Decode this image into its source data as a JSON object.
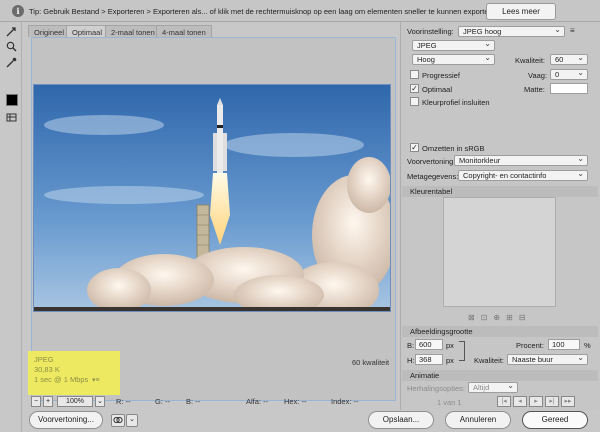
{
  "tipbar": {
    "tip": "Tip: Gebruik Bestand > Exporteren > Exporteren als... of klik met de rechtermuisknop op een laag om elementen sneller te kunnen exporteren",
    "button": "Lees meer"
  },
  "tabs": [
    "Origineel",
    "Optimaal",
    "2-maal tonen",
    "4-maal tonen"
  ],
  "preview": {
    "info": [
      "JPEG",
      "30,83 K",
      "1 sec @ 1 Mbps"
    ],
    "quality": "60 kwaliteit"
  },
  "status": {
    "zoom": "100%",
    "r": "R: --",
    "g": "G: --",
    "b": "B: --",
    "alfa": "Alfa: --",
    "hex": "Hex: --",
    "index": "Index: --"
  },
  "buttons": {
    "preview": "Voorvertoning...",
    "save": "Opslaan...",
    "cancel": "Annuleren",
    "done": "Gereed"
  },
  "settings": {
    "preset_label": "Voorinstelling:",
    "preset": "JPEG hoog",
    "format": "JPEG",
    "quality_level": "Hoog",
    "quality_label": "Kwaliteit:",
    "quality_value": "60",
    "progressive": "Progressief",
    "blur_label": "Vaag:",
    "blur_value": "0",
    "optimized": "Optimaal",
    "matte_label": "Matte:",
    "icc": "Kleurprofiel insluiten",
    "srgb": "Omzetten in sRGB",
    "preview_label": "Voorvertoning:",
    "preview_value": "Monitorkleur",
    "meta_label": "Metagegevens:",
    "meta_value": "Copyright- en contactinfo"
  },
  "colortable": {
    "title": "Kleurentabel"
  },
  "imagesize": {
    "title": "Afbeeldingsgrootte",
    "w_label": "B:",
    "w_value": "600",
    "h_label": "H:",
    "h_value": "368",
    "unit": "px",
    "percent_label": "Procent:",
    "percent_value": "100",
    "percent_unit": "%",
    "quality_label": "Kwaliteit:",
    "quality_value": "Naaste buur"
  },
  "animation": {
    "title": "Animatie",
    "loop_label": "Herhalingsopties:",
    "loop_value": "Altijd",
    "frame": "1 van 1"
  }
}
